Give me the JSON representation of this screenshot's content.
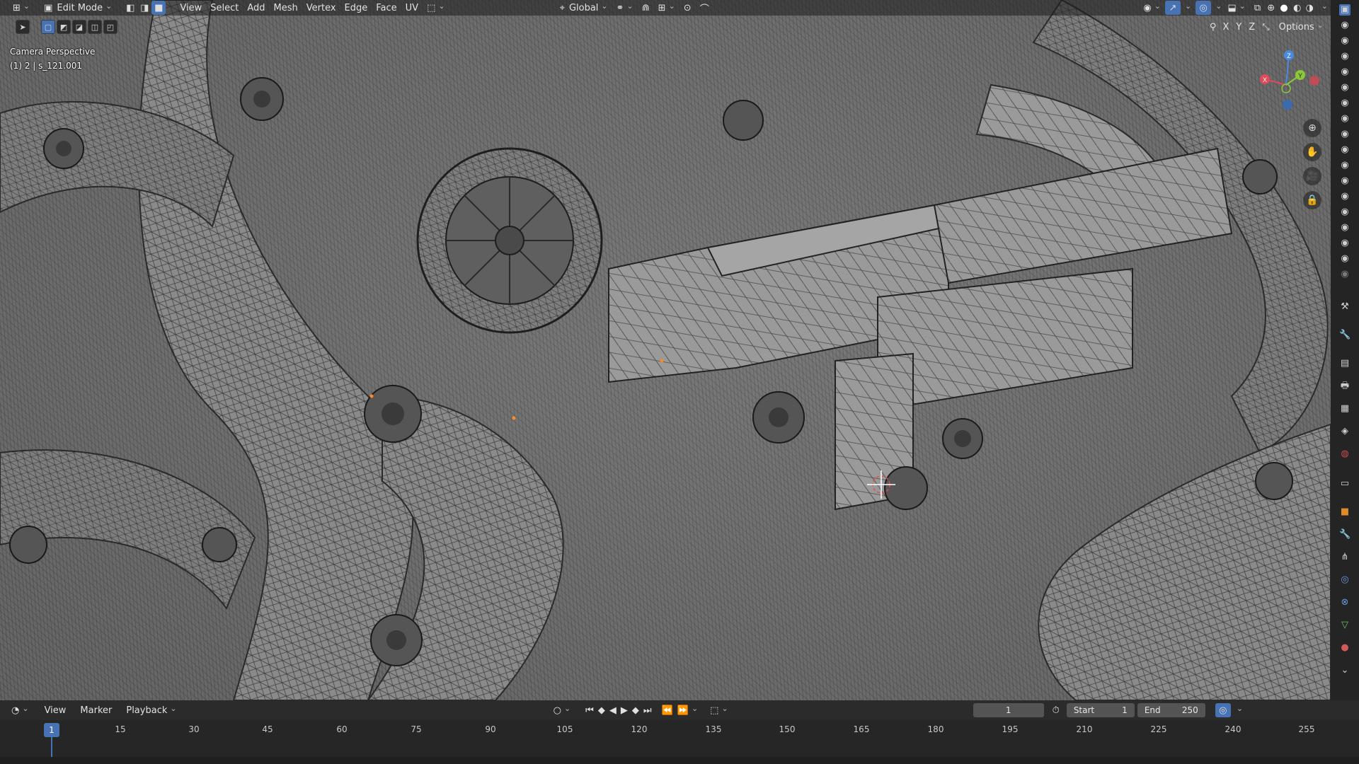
{
  "header": {
    "mode": "Edit Mode",
    "menus": [
      "View",
      "Select",
      "Add",
      "Mesh",
      "Vertex",
      "Edge",
      "Face",
      "UV"
    ],
    "orientation": "Global",
    "options": "Options",
    "axes": [
      "X",
      "Y",
      "Z"
    ]
  },
  "viewport": {
    "camera_label": "Camera Perspective",
    "object_label": "(1) 2 | s_121.001",
    "gizmo": {
      "x": "X",
      "y": "Y",
      "z": "Z"
    }
  },
  "timeline": {
    "menus": [
      "View",
      "Marker",
      "Playback"
    ],
    "current_frame": "1",
    "start_label": "Start",
    "start_value": "1",
    "end_label": "End",
    "end_value": "250",
    "playhead": "1",
    "ticks": [
      "15",
      "30",
      "45",
      "60",
      "75",
      "90",
      "105",
      "120",
      "135",
      "150",
      "165",
      "180",
      "195",
      "210",
      "225",
      "240",
      "255"
    ]
  },
  "colors": {
    "accent": "#4772b3",
    "axis_x": "#e04a5a",
    "axis_y": "#8bc83a",
    "axis_z": "#4a8ae0"
  }
}
